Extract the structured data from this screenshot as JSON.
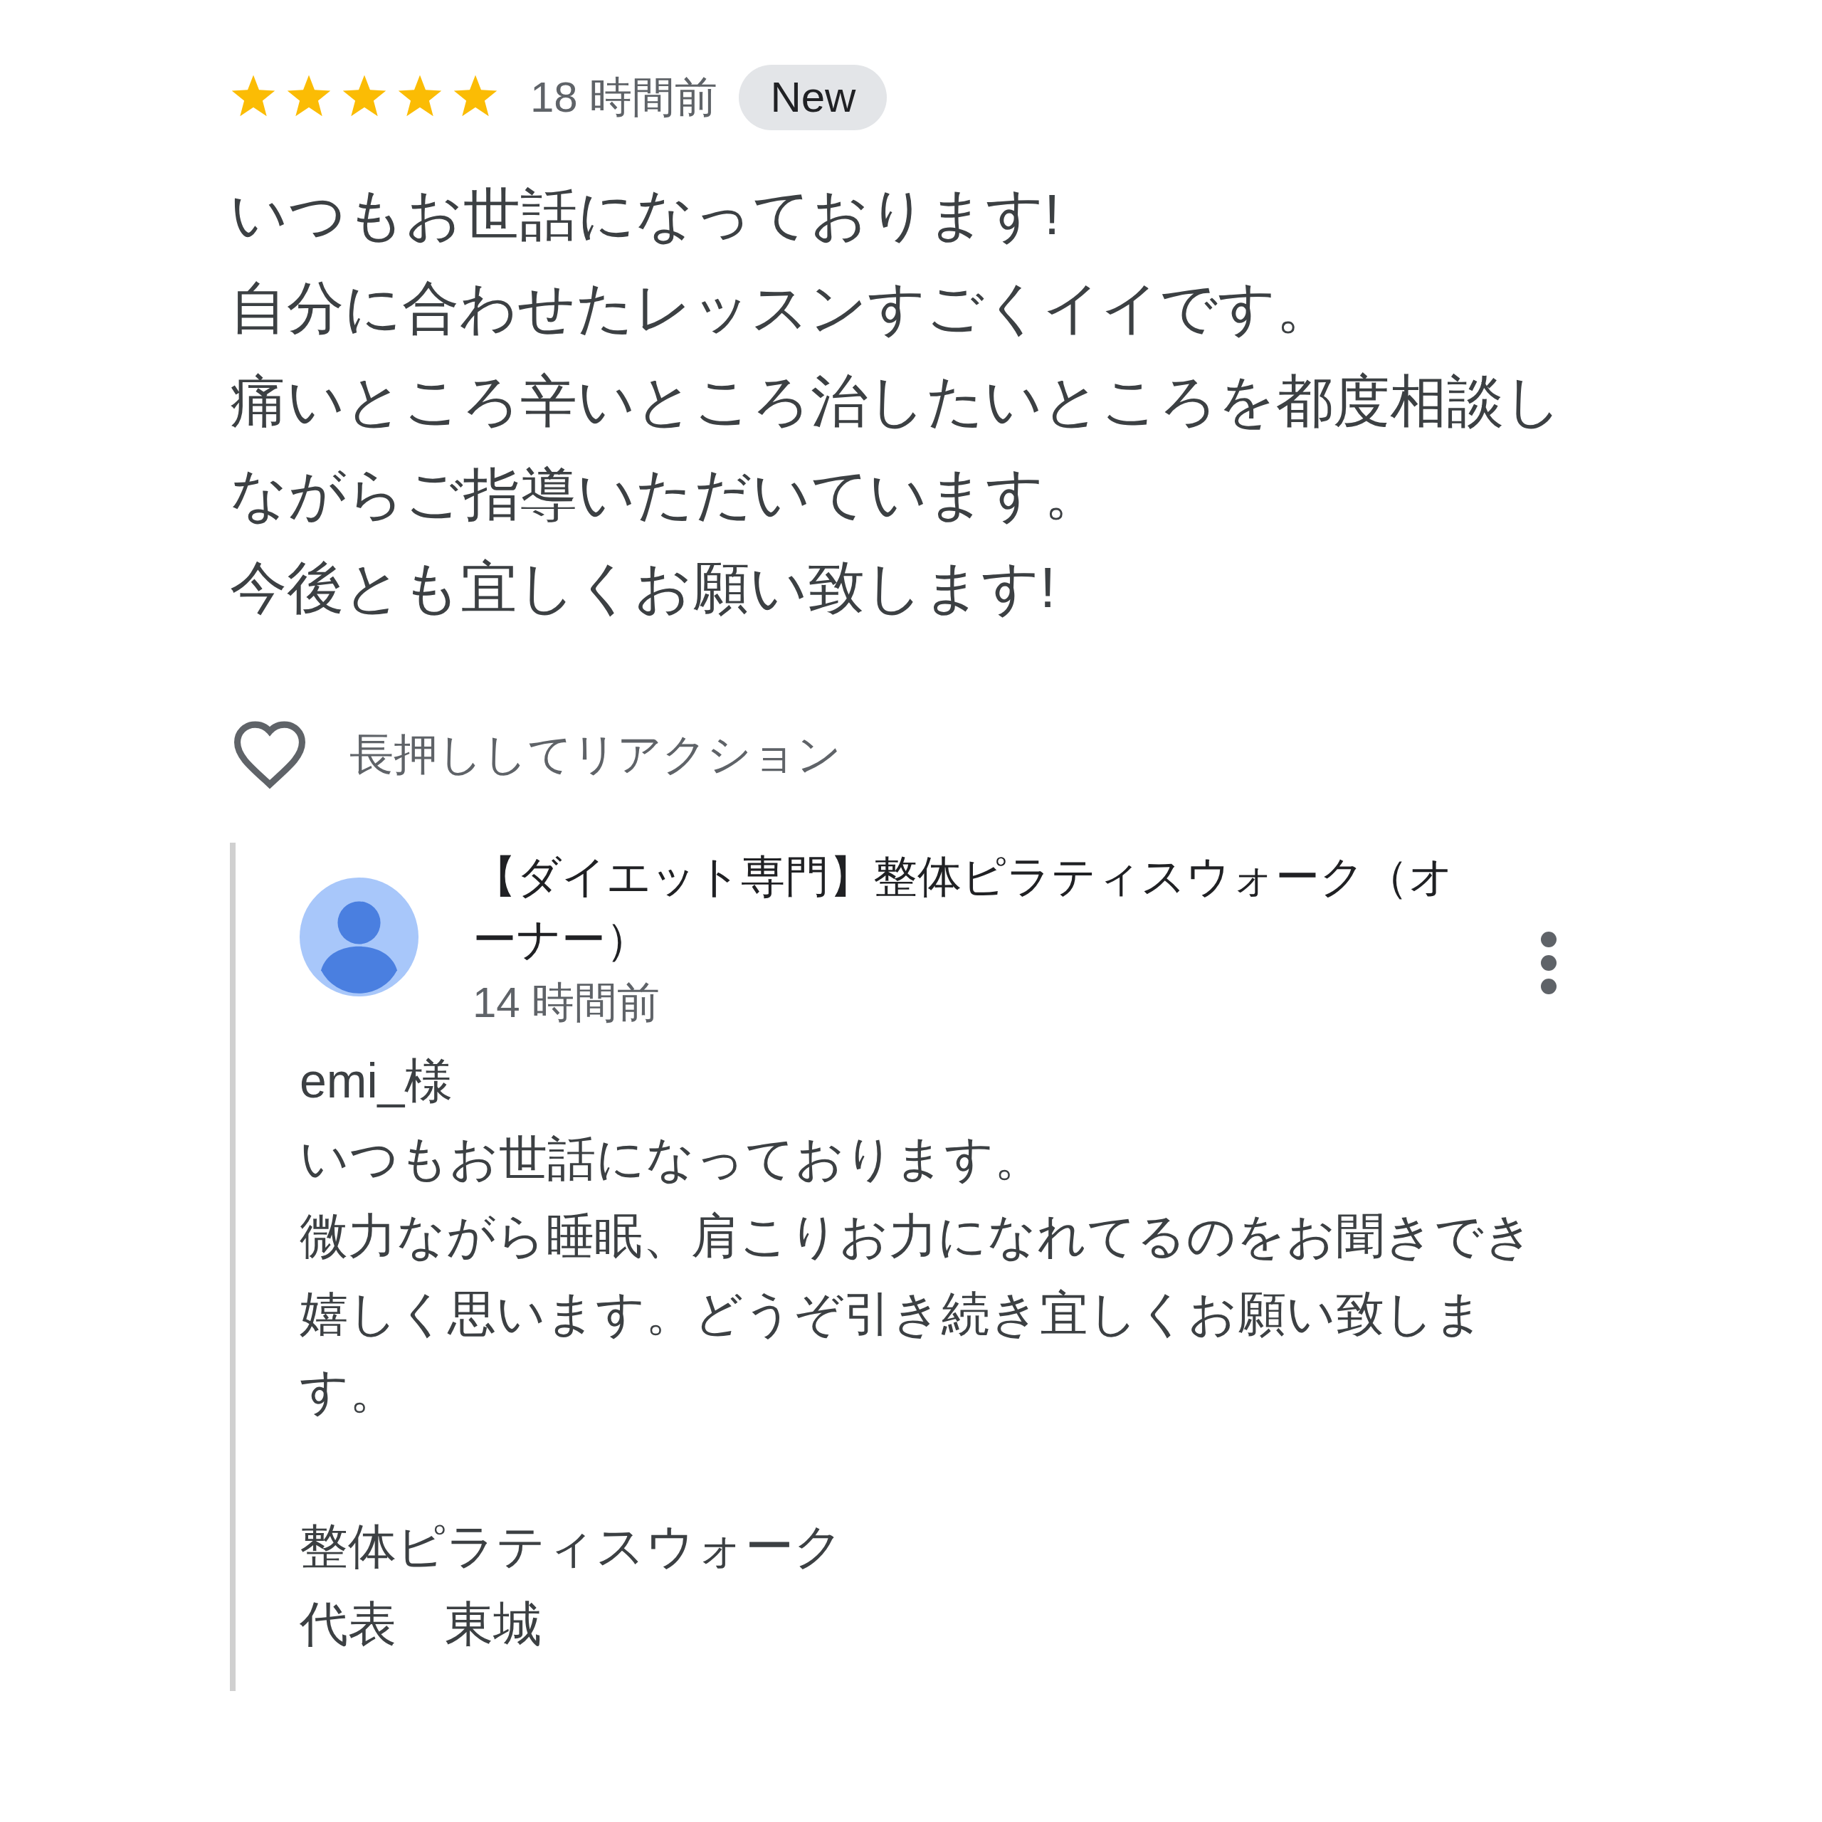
{
  "review": {
    "stars": 5,
    "time": "18 時間前",
    "badge": "New",
    "lines": [
      "いつもお世話になっております!",
      "自分に合わせたレッスンすごくイイです。",
      "痛いところ辛いところ治したいところを都度相談し",
      "ながらご指導いただいています。",
      "今後とも宜しくお願い致します!"
    ],
    "reaction": {
      "label": "長押ししてリアクション",
      "liked": false
    }
  },
  "reply": {
    "author": "【ダイエット専門】整体ピラティスウォーク（オーナー）",
    "time": "14 時間前",
    "paragraphs": [
      [
        "emi_様",
        "いつもお世話になっております。",
        "微力ながら睡眠、肩こりお力になれてるのをお聞きでき",
        "嬉しく思います。どうぞ引き続き宜しくお願い致しま",
        "す。"
      ],
      [
        "整体ピラティスウォーク",
        "代表　東城"
      ]
    ]
  }
}
